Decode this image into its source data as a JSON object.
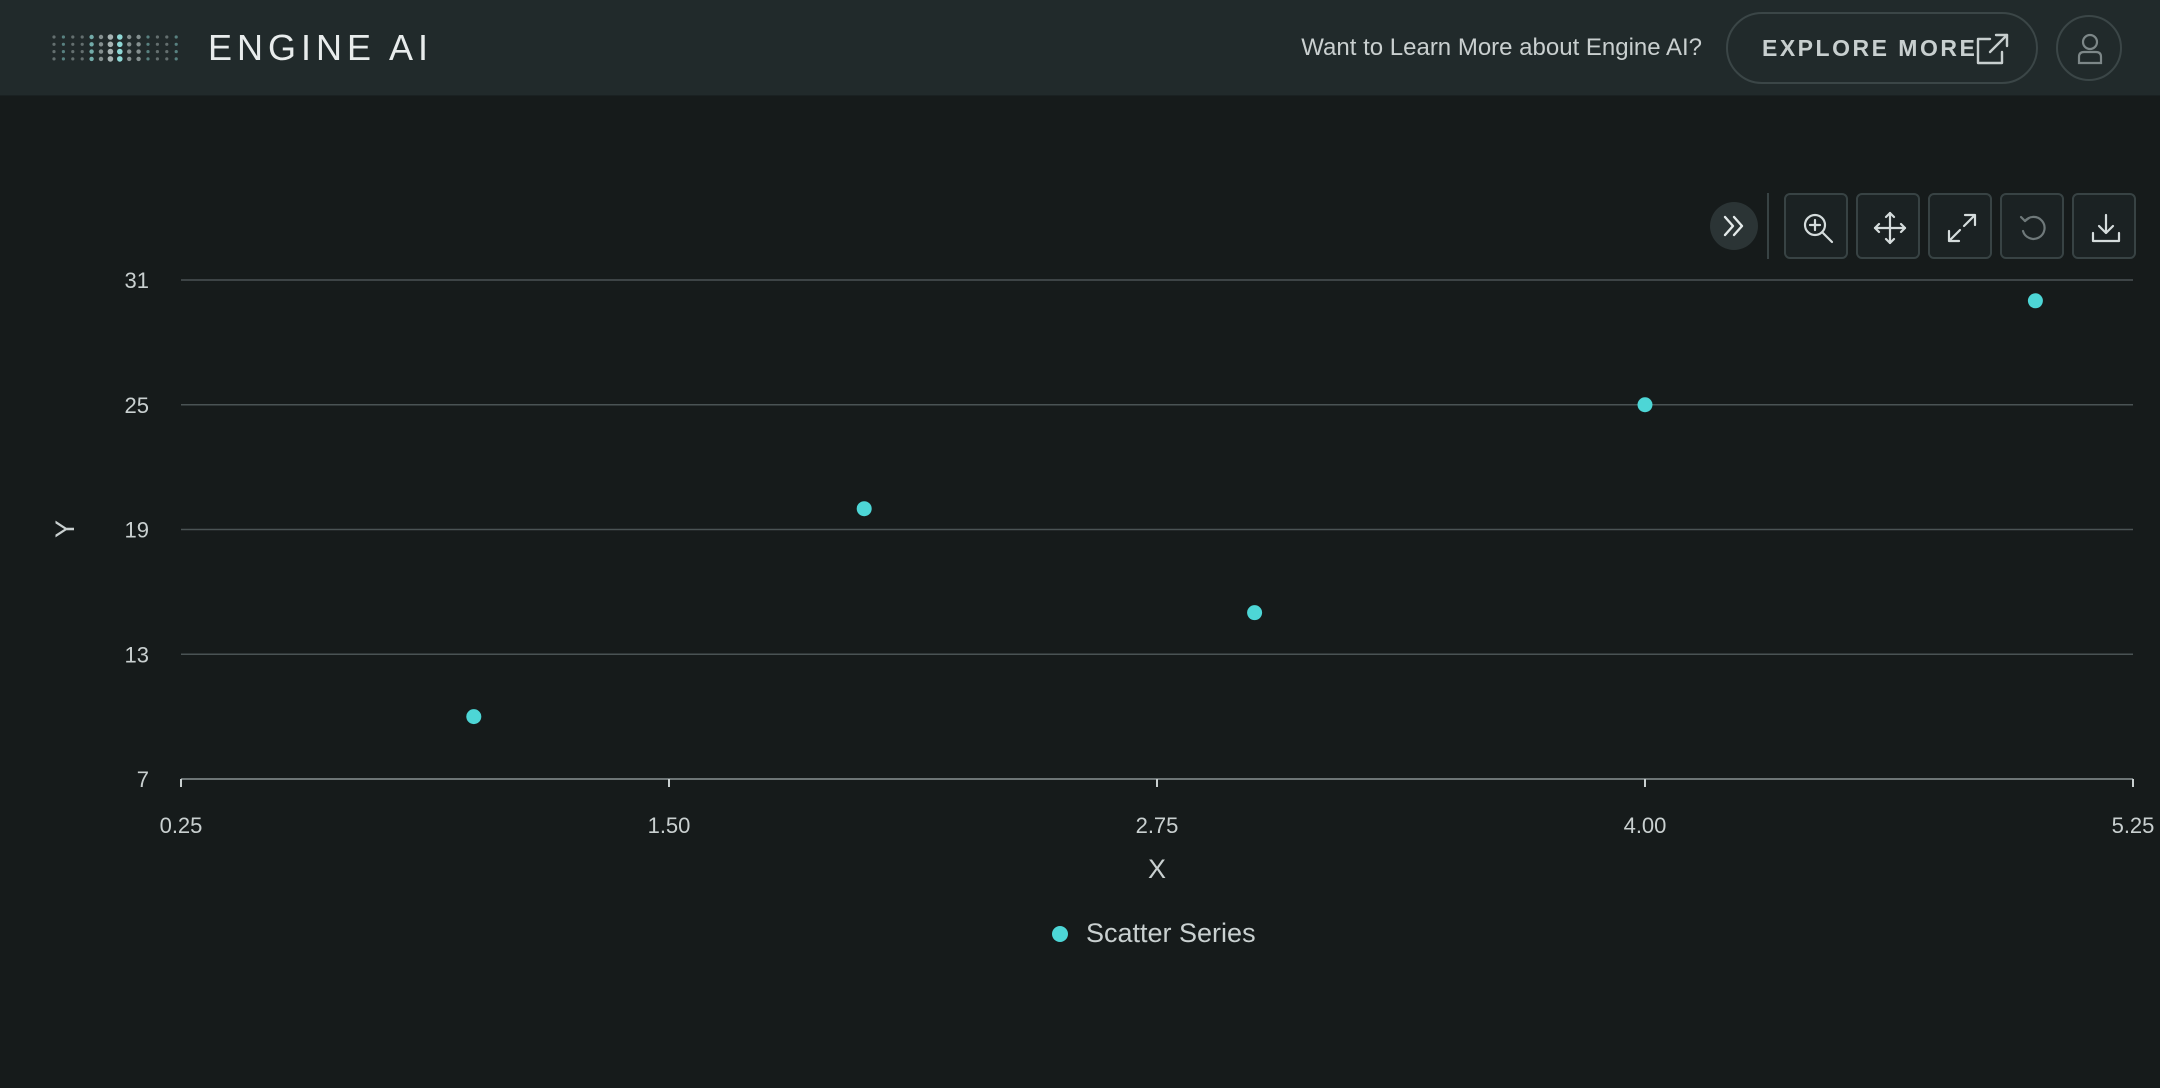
{
  "header": {
    "logo_text": "ENGINE AI",
    "promo_text": "Want to Learn More about Engine AI?",
    "explore_label": "EXPLORE MORE"
  },
  "toolbar": {
    "icons": [
      "collapse-icon",
      "zoom-in-icon",
      "pan-icon",
      "fullscreen-icon",
      "reset-icon",
      "download-icon"
    ]
  },
  "colors": {
    "accent": "#4dd6d6",
    "background": "#161b1b",
    "header": "#212a2b",
    "grid": "#4a5354",
    "text": "#c9d0d0"
  },
  "chart_data": {
    "type": "scatter",
    "title": "",
    "xlabel": "X",
    "ylabel": "Y",
    "xlim": [
      0.25,
      5.25
    ],
    "ylim": [
      7,
      31
    ],
    "x_ticks": [
      "0.25",
      "1.50",
      "2.75",
      "4.00",
      "5.25"
    ],
    "y_ticks": [
      "31",
      "25",
      "19",
      "13",
      "7"
    ],
    "grid": true,
    "legend_position": "bottom",
    "series": [
      {
        "name": "Scatter Series",
        "x": [
          1.0,
          2.0,
          3.0,
          4.0,
          5.0
        ],
        "y": [
          10,
          20,
          15,
          25,
          30
        ]
      }
    ]
  }
}
